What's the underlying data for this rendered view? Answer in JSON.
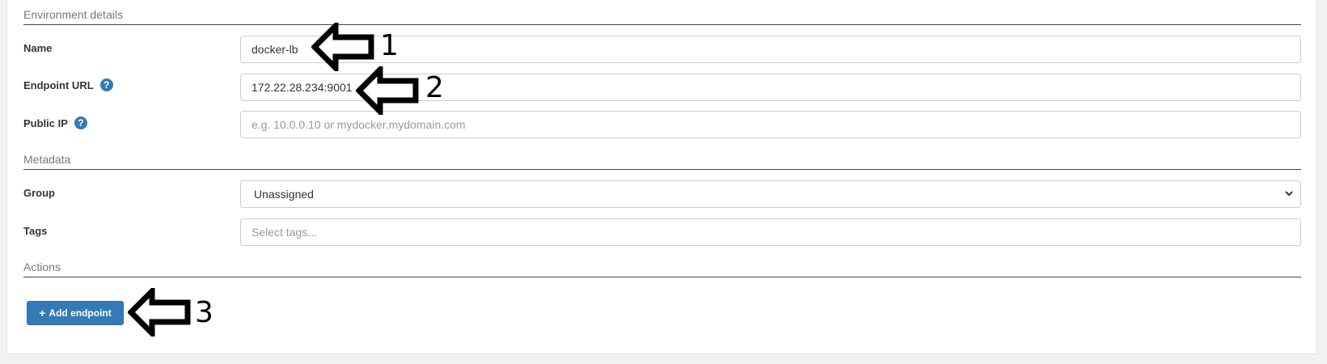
{
  "sections": {
    "environment": "Environment details",
    "metadata": "Metadata",
    "actions": "Actions"
  },
  "fields": {
    "name": {
      "label": "Name",
      "value": "docker-lb"
    },
    "endpoint_url": {
      "label": "Endpoint URL",
      "value": "172.22.28.234:9001"
    },
    "public_ip": {
      "label": "Public IP",
      "placeholder": "e.g. 10.0.0.10 or mydocker.mydomain.com"
    },
    "group": {
      "label": "Group",
      "value": "Unassigned"
    },
    "tags": {
      "label": "Tags",
      "placeholder": "Select tags..."
    }
  },
  "help_icon_glyph": "?",
  "add_button": {
    "label": "Add endpoint",
    "icon": "plus-icon"
  },
  "annotations": [
    "1",
    "2",
    "3"
  ],
  "colors": {
    "primary": "#337ab7",
    "arrow": "#000000"
  }
}
